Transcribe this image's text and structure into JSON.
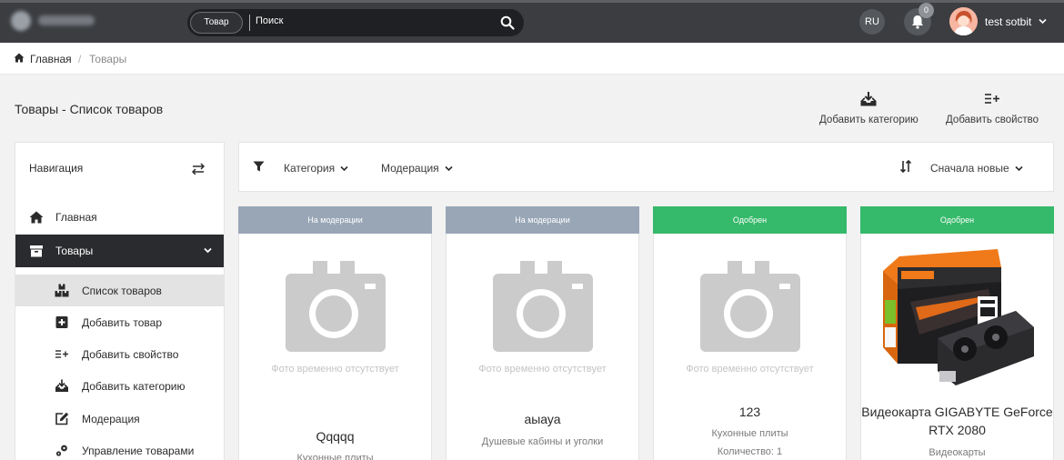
{
  "topbar": {
    "search_scope": "Товар",
    "search_placeholder": "Поиск",
    "language": "RU",
    "notifications_count": "0",
    "user_name": "test sotbit"
  },
  "breadcrumb": {
    "home": "Главная",
    "current": "Товары"
  },
  "page": {
    "title": "Товары - Список товаров",
    "actions": [
      {
        "label": "Добавить категорию",
        "icon": "inbox-download-icon"
      },
      {
        "label": "Добавить свойство",
        "icon": "list-plus-icon"
      }
    ]
  },
  "sidebar": {
    "heading": "Навигация",
    "items": [
      {
        "label": "Главная",
        "icon": "home-icon"
      },
      {
        "label": "Товары",
        "icon": "box-icon"
      }
    ],
    "subitems": [
      {
        "label": "Список товаров",
        "icon": "boxes-icon"
      },
      {
        "label": "Добавить товар",
        "icon": "plus-square-icon"
      },
      {
        "label": "Добавить свойство",
        "icon": "list-plus-icon"
      },
      {
        "label": "Добавить категорию",
        "icon": "inbox-download-icon"
      },
      {
        "label": "Модерация",
        "icon": "edit-icon"
      },
      {
        "label": "Управление товарами",
        "icon": "gears-icon"
      }
    ]
  },
  "filters": {
    "category": "Категория",
    "moderation": "Модерация",
    "sort": "Сначала новые"
  },
  "products": [
    {
      "status": "На модерации",
      "status_color": "#98a6b6",
      "no_photo": "Фото временно отсутствует",
      "name": "Qqqqq",
      "category": "Кухонные плиты",
      "quantity": ""
    },
    {
      "status": "На модерации",
      "status_color": "#98a6b6",
      "no_photo": "Фото временно отсутствует",
      "name": "аыауа",
      "category": "Душевые кабины и уголки",
      "quantity": ""
    },
    {
      "status": "Одобрен",
      "status_color": "#35b96a",
      "no_photo": "Фото временно отсутствует",
      "name": "123",
      "category": "Кухонные плиты",
      "quantity": "Количество: 1"
    },
    {
      "status": "Одобрен",
      "status_color": "#35b96a",
      "no_photo": "",
      "name": "Видеокарта GIGABYTE GeForce RTX 2080",
      "category": "Видеокарты",
      "quantity": ""
    }
  ],
  "colors": {
    "topbar": "#3b3d40",
    "active_nav": "#2a2b2e",
    "moderation": "#98a6b6",
    "approved": "#35b96a"
  }
}
